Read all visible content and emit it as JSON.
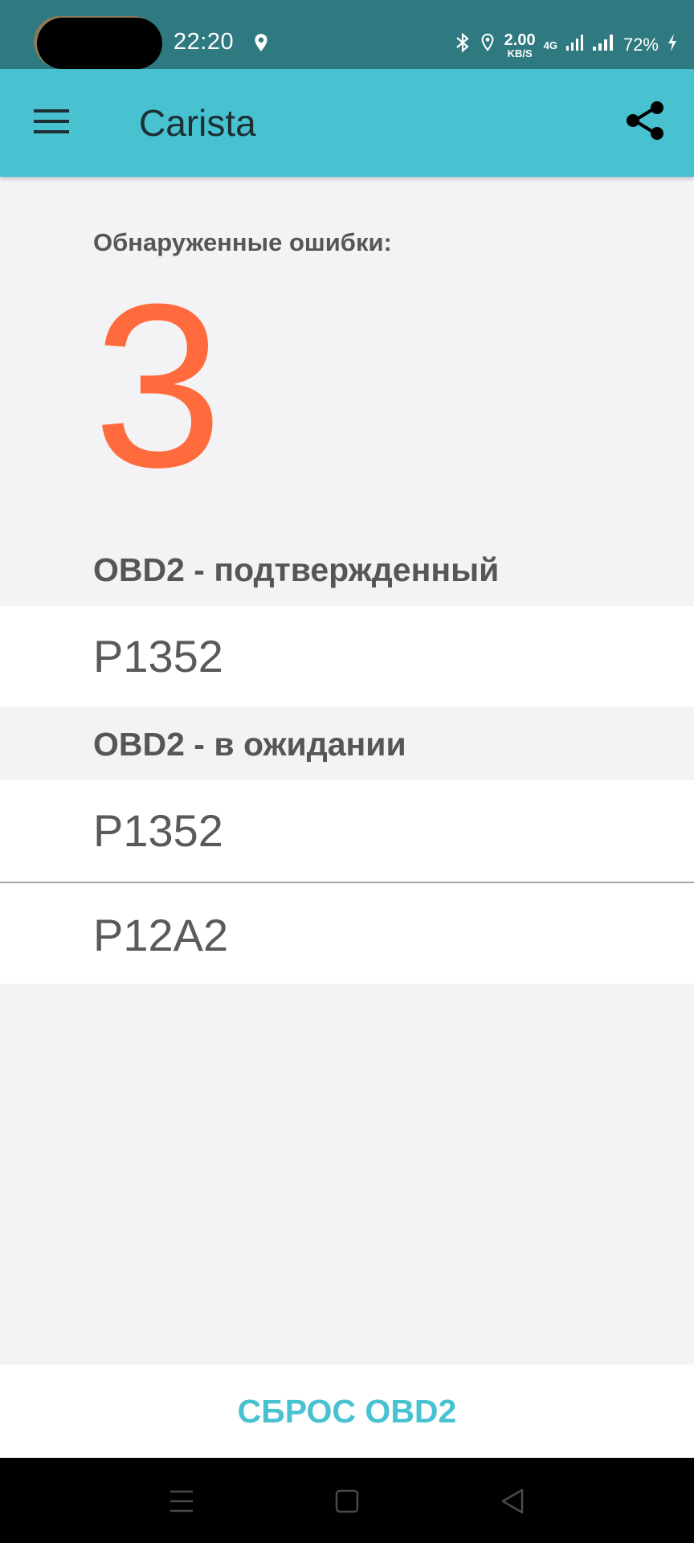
{
  "status_bar": {
    "time": "22:20",
    "net_speed_value": "2.00",
    "net_speed_unit": "KB/S",
    "network_type": "4G",
    "battery": "72%"
  },
  "app_bar": {
    "title": "Carista",
    "menu_icon": "hamburger-menu-icon",
    "share_icon": "share-icon"
  },
  "errors": {
    "label": "Обнаруженные ошибки:",
    "count": "3"
  },
  "sections": [
    {
      "title": "OBD2 - подтвержденный",
      "codes": [
        "P1352"
      ]
    },
    {
      "title": "OBD2 - в ожидании",
      "codes": [
        "P1352",
        "P12A2"
      ]
    }
  ],
  "reset_button": {
    "label": "СБРОС OBD2"
  },
  "nav_bar": {
    "icons": [
      "recents-icon",
      "home-icon",
      "back-icon"
    ]
  },
  "colors": {
    "app_bar": "#48c1d0",
    "status_bar": "#2f7a80",
    "error_count": "#ff6b3d",
    "reset_button_text": "#48c1d0"
  }
}
